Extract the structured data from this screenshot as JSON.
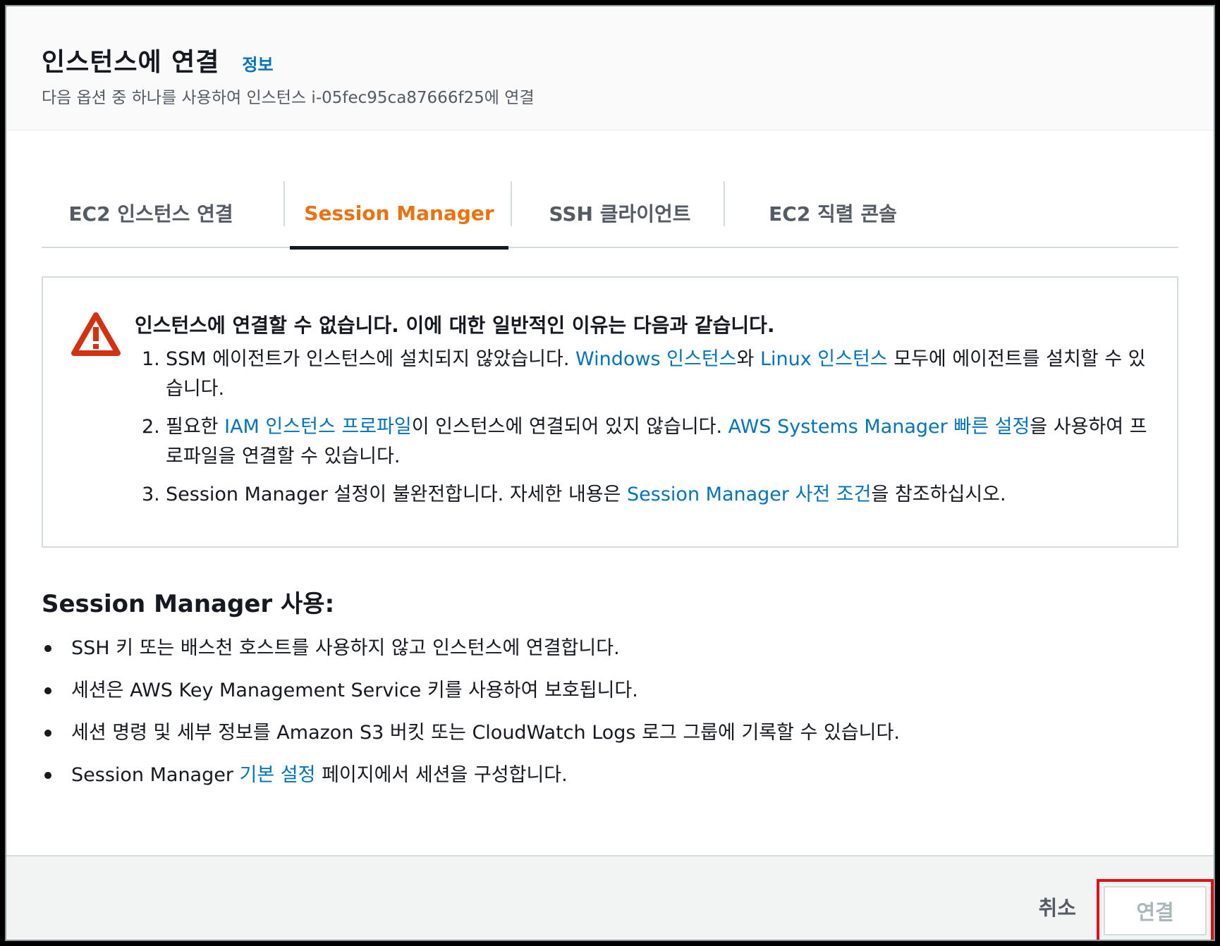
{
  "header": {
    "title": "인스턴스에 연결",
    "info_link": "정보",
    "subtitle": "다음 옵션 중 하나를 사용하여 인스턴스 i-05fec95ca87666f25에 연결"
  },
  "tabs": [
    {
      "label": "EC2 인스턴스 연결",
      "active": false
    },
    {
      "label": "Session Manager",
      "active": true
    },
    {
      "label": "SSH 클라이언트",
      "active": false
    },
    {
      "label": "EC2 직렬 콘솔",
      "active": false
    }
  ],
  "alert": {
    "icon": "warning-triangle-icon",
    "title": "인스턴스에 연결할 수 없습니다. 이에 대한 일반적인 이유는 다음과 같습니다.",
    "items": [
      {
        "num": "1.",
        "text_1": "SSM 에이전트가 인스턴스에 설치되지 않았습니다. ",
        "link_1": "Windows 인스턴스",
        "text_2": "와 ",
        "link_2": "Linux 인스턴스",
        "text_3": " 모두에 에이전트를 설치할 수 있습니다."
      },
      {
        "num": "2.",
        "text_1": "필요한 ",
        "link_1": "IAM 인스턴스 프로파일",
        "text_2": "이 인스턴스에 연결되어 있지 않습니다. ",
        "link_2": "AWS Systems Manager 빠른 설정",
        "text_3": "을 사용하여 프로파일을 연결할 수 있습니다."
      },
      {
        "num": "3.",
        "text_1": "Session Manager 설정이 불완전합니다. 자세한 내용은 ",
        "link_1": "Session Manager 사전 조건",
        "text_2": "을 참조하십시오."
      }
    ]
  },
  "usage": {
    "heading": "Session Manager 사용:",
    "items": [
      {
        "text": "SSH 키 또는 배스천 호스트를 사용하지 않고 인스턴스에 연결합니다."
      },
      {
        "text": "세션은 AWS Key Management Service 키를 사용하여 보호됩니다."
      },
      {
        "text": "세션 명령 및 세부 정보를 Amazon S3 버킷 또는 CloudWatch Logs 로그 그룹에 기록할 수 있습니다."
      },
      {
        "text_1": "Session Manager ",
        "link": "기본 설정",
        "text_2": " 페이지에서 세션을 구성합니다."
      }
    ]
  },
  "footer": {
    "cancel_label": "취소",
    "connect_label": "연결",
    "connect_disabled": true
  },
  "colors": {
    "link": "#0073bb",
    "active_tab": "#ec7211",
    "warning": "#d13212",
    "highlight": "#e0101b"
  }
}
